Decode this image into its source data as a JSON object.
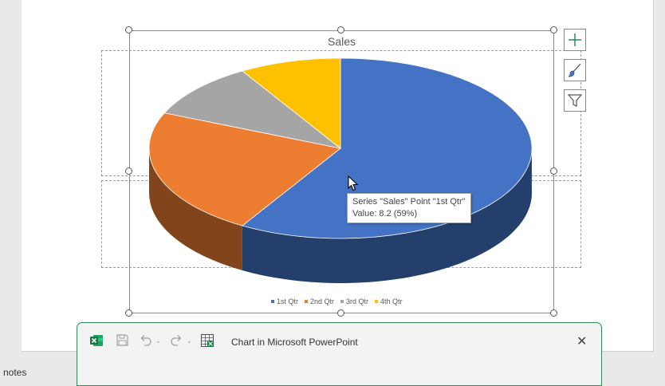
{
  "chart_data": {
    "type": "pie",
    "title": "Sales",
    "categories": [
      "1st Qtr",
      "2nd Qtr",
      "3rd Qtr",
      "4th Qtr"
    ],
    "series": [
      {
        "name": "Sales",
        "values": [
          8.2,
          3.2,
          1.4,
          1.2
        ]
      }
    ],
    "colors": [
      "#4472c4",
      "#ed7d31",
      "#a5a5a5",
      "#ffc000"
    ],
    "three_d": true,
    "legend": "bottom"
  },
  "tooltip": {
    "line1": "Series \"Sales\" Point \"1st Qtr\"",
    "line2": "Value: 8.2 (59%)"
  },
  "chart_tools": {
    "add_element_icon": "plus-icon",
    "style_icon": "brush-icon",
    "filter_icon": "filter-icon"
  },
  "excel_window": {
    "title": "Chart in Microsoft PowerPoint",
    "app_icon": "excel-icon",
    "save_icon": "save-icon",
    "undo_icon": "undo-icon",
    "redo_icon": "redo-icon",
    "data_icon": "edit-data-icon",
    "close_icon": "close-icon",
    "caret": "⌄",
    "close_glyph": "✕"
  },
  "notes": {
    "text": "notes"
  }
}
